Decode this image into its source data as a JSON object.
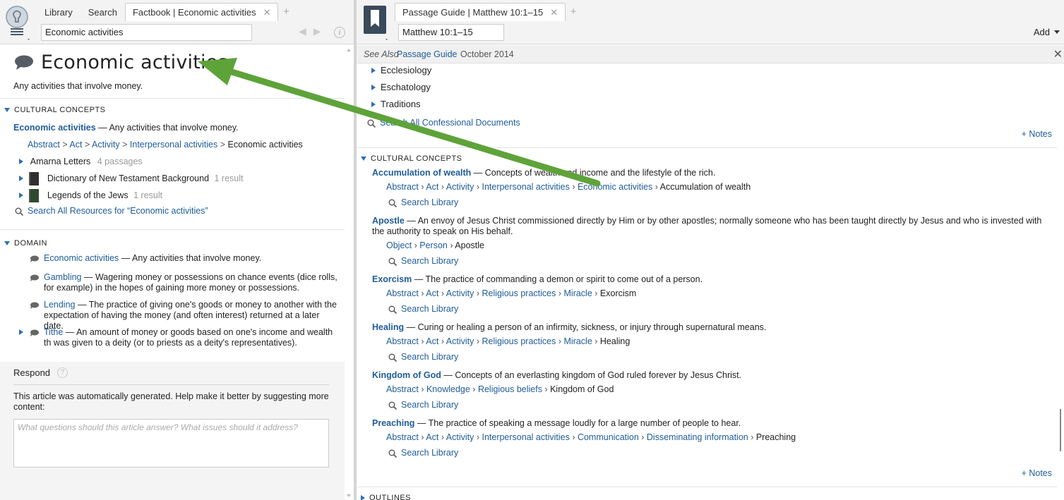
{
  "left": {
    "tabs": [
      {
        "label": "Library"
      },
      {
        "label": "Search"
      },
      {
        "label": "Factbook | Economic activities"
      }
    ],
    "search_value": "Economic activities",
    "article": {
      "title": "Economic activities",
      "description": "Any activities that involve money."
    },
    "cultural": {
      "heading": "CULTURAL CONCEPTS",
      "term": "Economic activities",
      "term_desc": " — Any activities that involve money.",
      "crumbs": [
        "Abstract",
        "Act",
        "Activity",
        "Interpersonal activities"
      ],
      "crumb_last": "Economic activities",
      "resources": [
        {
          "label": "Amarna Letters",
          "count": "4 passages"
        },
        {
          "label": "Dictionary of New Testament Background",
          "count": "1 result"
        },
        {
          "label": "Legends of the Jews",
          "count": "1 result"
        }
      ],
      "search_all": "Search All Resources for “Economic activities”"
    },
    "domain": {
      "heading": "DOMAIN",
      "items": [
        {
          "term": "Economic activities",
          "desc": " — Any activities that involve money."
        },
        {
          "term": "Gambling",
          "desc": " — Wagering money or possessions on chance events (dice rolls, for example) in the hopes of gaining more money or possessions."
        },
        {
          "term": "Lending",
          "desc": " — The practice of giving one's goods or money to another with the expectation of having the money (and often interest) returned at a later date."
        },
        {
          "term": "Tithe",
          "desc": " — An amount of money or goods based on one's income and wealth th was given to a deity (or to priests as a deity's representatives)."
        }
      ]
    },
    "respond": {
      "title": "Respond",
      "text": "This article was automatically generated. Help make it better by suggesting more content:",
      "placeholder": "What questions should this article answer? What issues should it address?"
    }
  },
  "right": {
    "tab": "Passage Guide | Matthew 10:1–15",
    "reference": "Matthew 10:1–15",
    "add_label": "Add",
    "see_also": {
      "label": "See Also",
      "link": "Passage Guide",
      "date": "October 2014"
    },
    "tree": [
      "Ecclesiology",
      "Eschatology",
      "Traditions"
    ],
    "search_confessional": "Search All Confessional Documents",
    "notes_label": "+ Notes",
    "cultural_heading": "CULTURAL CONCEPTS",
    "search_library": "Search Library",
    "concepts": [
      {
        "term": "Accumulation of wealth",
        "desc": " — Concepts of wealth and income and the lifestyle of the rich.",
        "crumbs": [
          "Abstract",
          "Act",
          "Activity",
          "Interpersonal activities",
          "Economic activities"
        ],
        "last": "Accumulation of wealth"
      },
      {
        "term": "Apostle",
        "desc": " — An envoy of Jesus Christ commissioned directly by Him or by other apostles; normally someone who has been taught directly by Jesus and who is invested with the authority to speak on His behalf.",
        "crumbs": [
          "Object",
          "Person"
        ],
        "last": "Apostle"
      },
      {
        "term": "Exorcism",
        "desc": " — The practice of commanding a demon or spirit to come out of a person.",
        "crumbs": [
          "Abstract",
          "Act",
          "Activity",
          "Religious practices",
          "Miracle"
        ],
        "last": "Exorcism"
      },
      {
        "term": "Healing",
        "desc": " — Curing or healing a person of an infirmity, sickness, or injury through supernatural means.",
        "crumbs": [
          "Abstract",
          "Act",
          "Activity",
          "Religious practices",
          "Miracle"
        ],
        "last": "Healing"
      },
      {
        "term": "Kingdom of God",
        "desc": " — Concepts of an everlasting kingdom of God ruled forever by Jesus Christ.",
        "crumbs": [
          "Abstract",
          "Knowledge",
          "Religious beliefs"
        ],
        "last": "Kingdom of God"
      },
      {
        "term": "Preaching",
        "desc": " — The practice of speaking a message loudly for a large number of people to hear.",
        "crumbs": [
          "Abstract",
          "Act",
          "Activity",
          "Interpersonal activities",
          "Communication",
          "Disseminating information"
        ],
        "last": "Preaching"
      }
    ],
    "outlines_heading": "OUTLINES"
  },
  "colors": {
    "link": "#1f5c99",
    "accent": "#2b6fb3",
    "arrow": "#5ea33a"
  }
}
